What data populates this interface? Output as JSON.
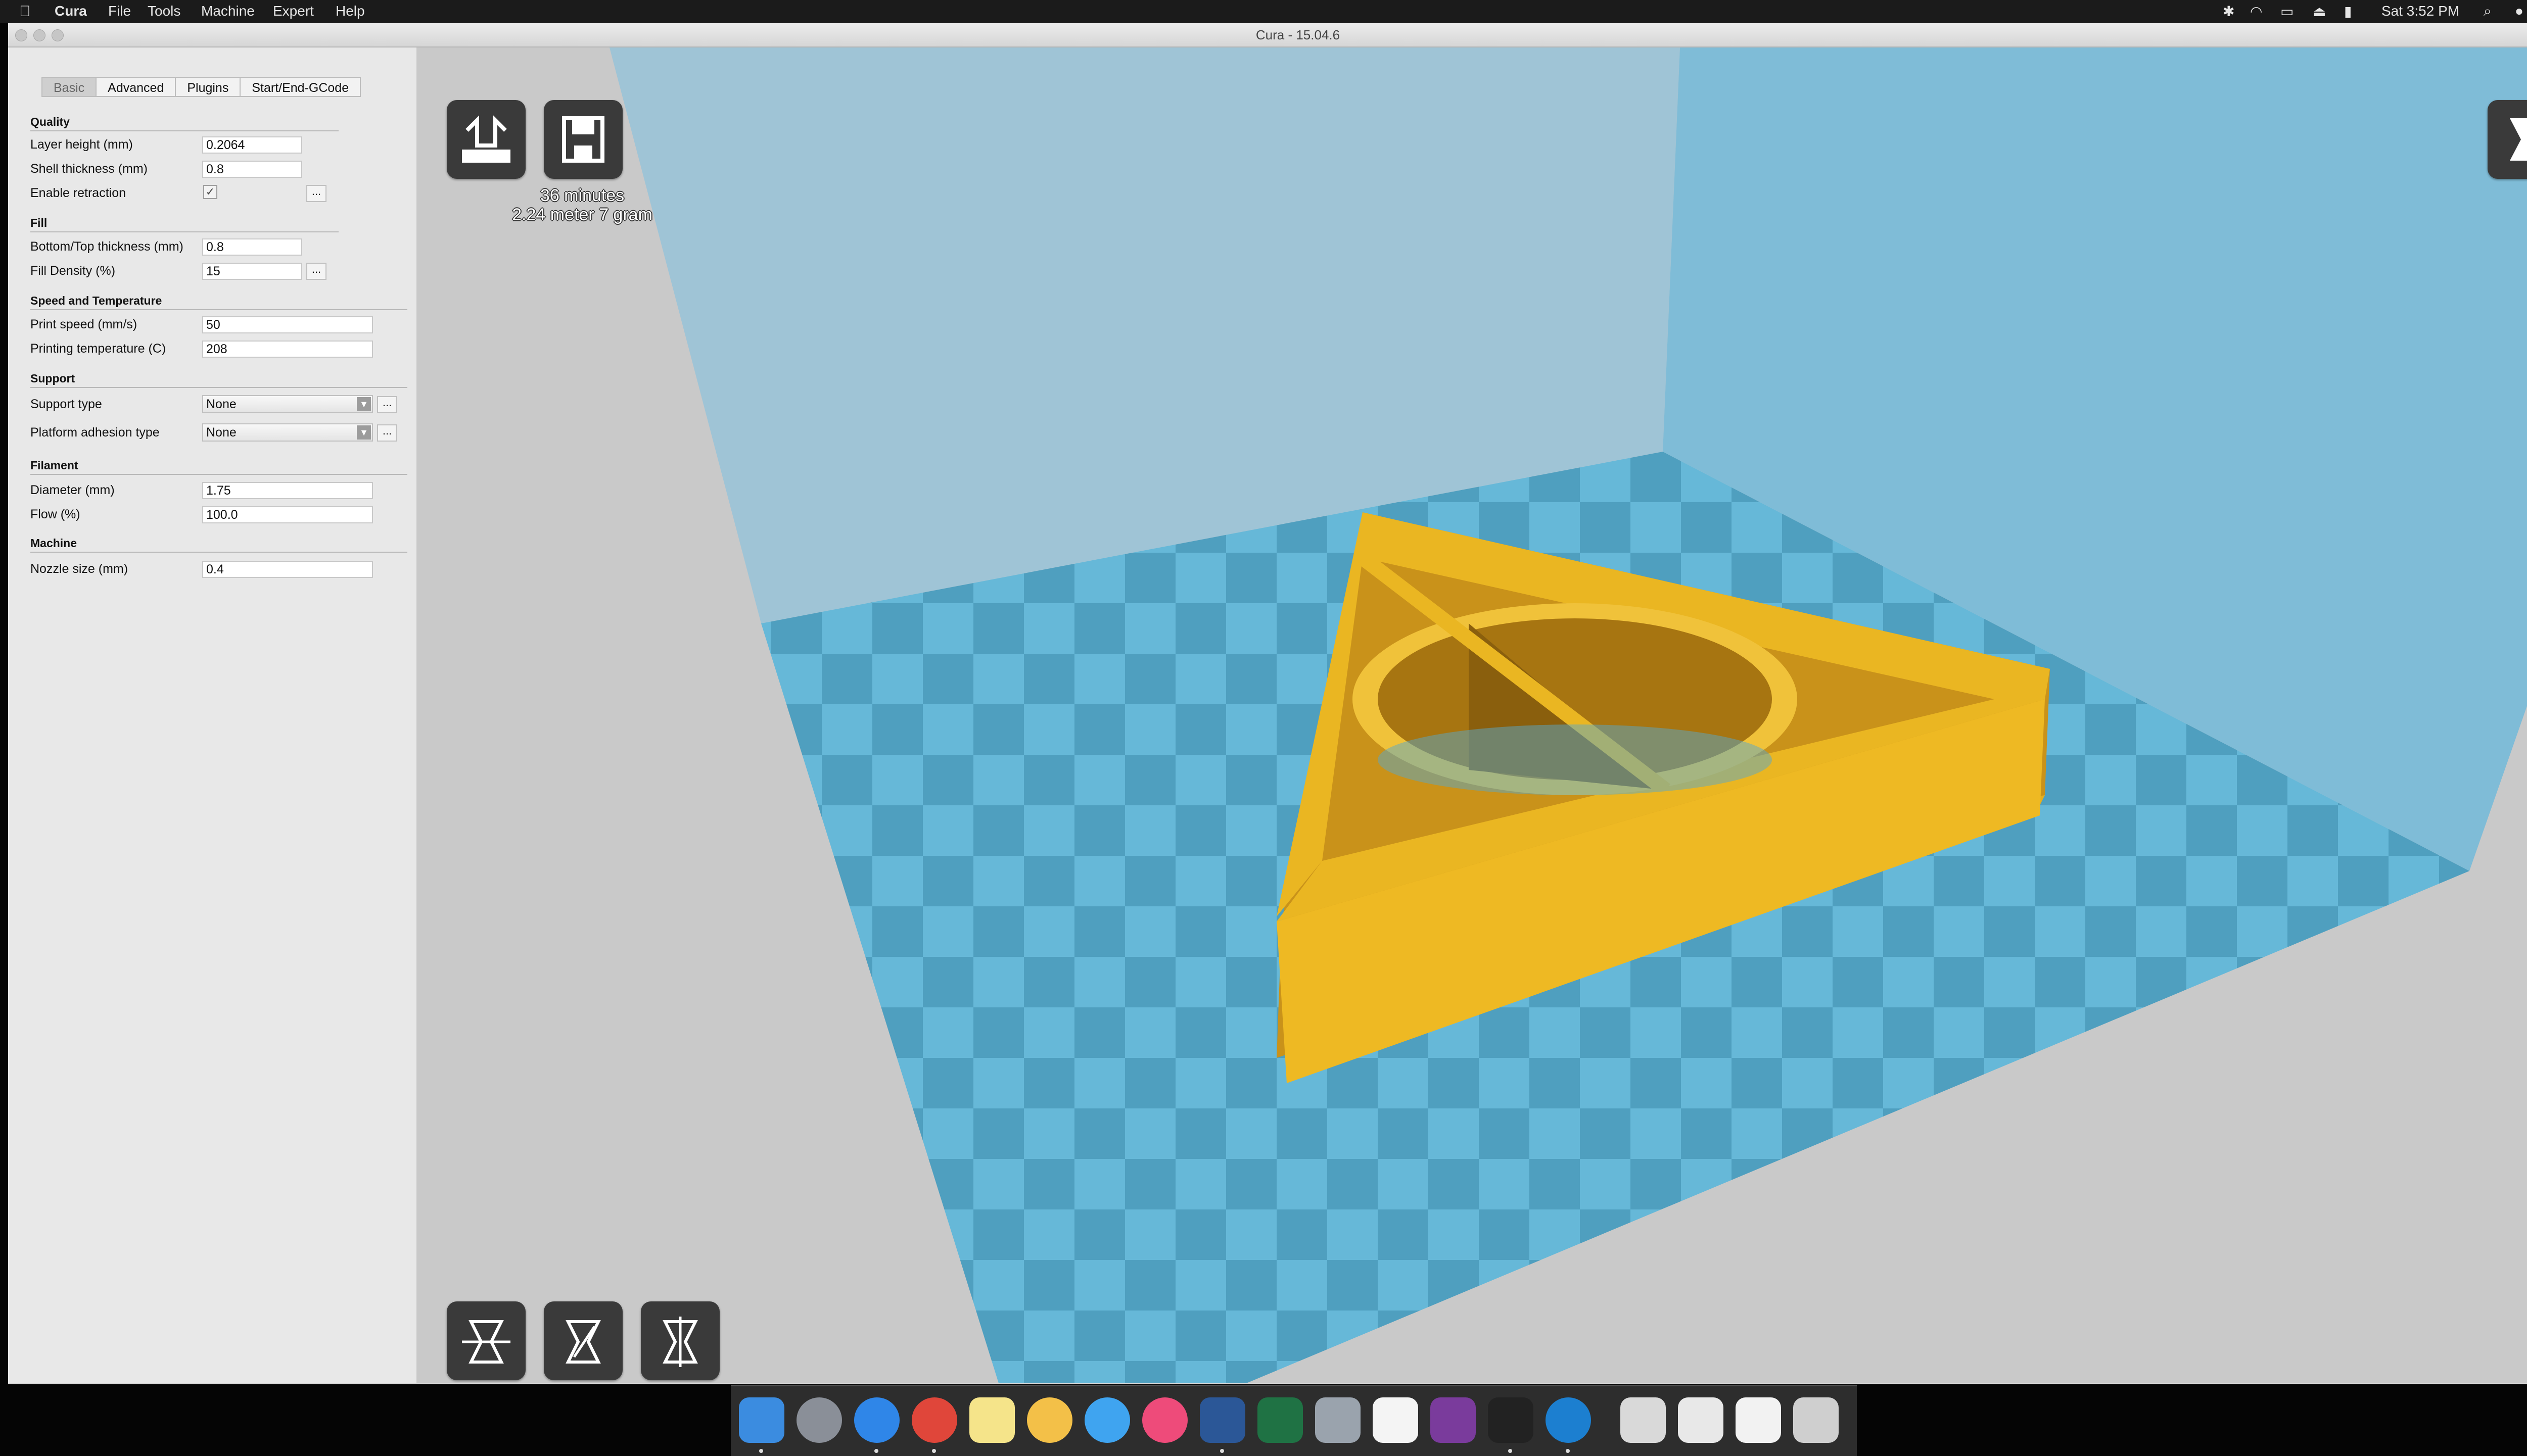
{
  "menubar": {
    "app_name": "Cura",
    "menus": [
      "File",
      "Tools",
      "Machine",
      "Expert",
      "Help"
    ],
    "clock": "Sat 3:52 PM"
  },
  "window": {
    "title": "Cura - 15.04.6"
  },
  "tabs": [
    "Basic",
    "Advanced",
    "Plugins",
    "Start/End-GCode"
  ],
  "active_tab": "Basic",
  "settings": {
    "quality": {
      "title": "Quality",
      "layer_height_label": "Layer height (mm)",
      "layer_height": "0.2064",
      "shell_thickness_label": "Shell thickness (mm)",
      "shell_thickness": "0.8",
      "enable_retraction_label": "Enable retraction",
      "enable_retraction": true
    },
    "fill": {
      "title": "Fill",
      "bottom_top_label": "Bottom/Top thickness (mm)",
      "bottom_top": "0.8",
      "fill_density_label": "Fill Density (%)",
      "fill_density": "15"
    },
    "speed": {
      "title": "Speed and Temperature",
      "print_speed_label": "Print speed (mm/s)",
      "print_speed": "50",
      "print_temp_label": "Printing temperature (C)",
      "print_temp": "208"
    },
    "support": {
      "title": "Support",
      "support_type_label": "Support type",
      "support_type": "None",
      "adhesion_label": "Platform adhesion type",
      "adhesion": "None"
    },
    "filament": {
      "title": "Filament",
      "diameter_label": "Diameter (mm)",
      "diameter": "1.75",
      "flow_label": "Flow (%)",
      "flow": "100.0"
    },
    "machine": {
      "title": "Machine",
      "nozzle_label": "Nozzle size (mm)",
      "nozzle": "0.4"
    },
    "more_button": "..."
  },
  "print_info": {
    "time": "36 minutes",
    "material": "2.24 meter 7 gram"
  },
  "icons": {
    "load": "load-model-icon",
    "save": "save-disk-icon",
    "view_mode": "view-mode-icon",
    "rotate": "rotate-icon",
    "scale": "scale-icon",
    "mirror": "mirror-icon"
  },
  "colors": {
    "model": "#eab622",
    "bed_light": "#65b7d6",
    "bed_dark": "#4a9dbd",
    "wall": "#7fbcd6",
    "floor": "#c8c8c8"
  }
}
